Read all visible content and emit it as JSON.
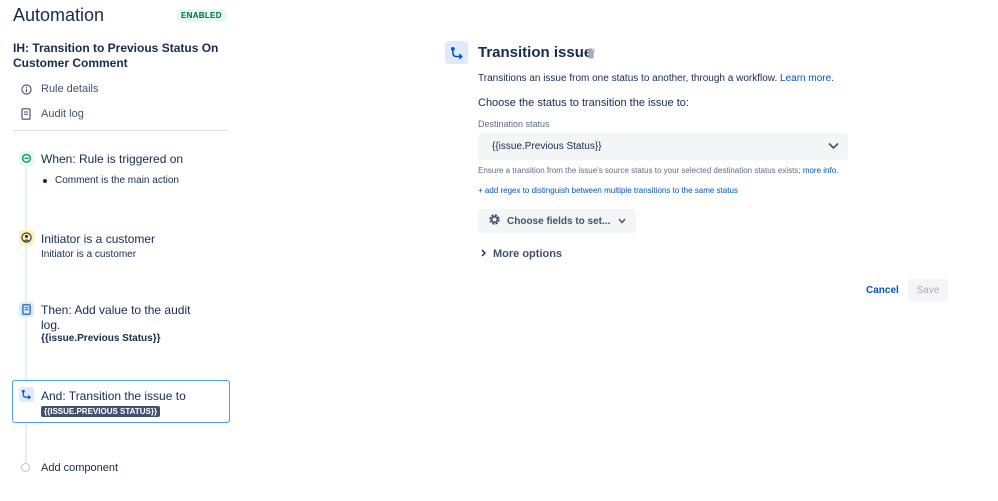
{
  "app": {
    "title": "Automation",
    "status_badge": "ENABLED"
  },
  "rule": {
    "name": "IH: Transition to Previous Status On Customer Comment"
  },
  "nav": [
    {
      "label": "Rule details",
      "icon": "info-icon"
    },
    {
      "label": "Audit log",
      "icon": "document-icon"
    }
  ],
  "steps": {
    "trigger": {
      "title": "When: Rule is triggered on",
      "bullet": "Comment is the main action",
      "icon": "speech-bubble-icon"
    },
    "condition": {
      "title": "Initiator is a customer",
      "subtitle": "Initiator is a customer",
      "icon": "user-circle-icon"
    },
    "action1": {
      "title_line1": "Then: Add value to the audit",
      "title_line2": "log.",
      "value": "{{issue.Previous Status}}",
      "icon": "audit-log-icon"
    },
    "action2": {
      "title": "And: Transition the issue to",
      "tag": "{{ISSUE.PREVIOUS STATUS}}",
      "icon": "transition-icon"
    },
    "add": {
      "label": "Add component"
    }
  },
  "panel": {
    "title": "Transition issue",
    "description": "Transitions an issue from one status to another, through a workflow.",
    "learn_more": "Learn more.",
    "choose_label": "Choose the status to transition the issue to:",
    "destination_label": "Destination status",
    "destination_value": "{{issue.Previous Status}}",
    "help_text": "Ensure a transition from the issue's source status to your selected destination status exists;",
    "help_link": "more info.",
    "regex_link": "+ add regex to distinguish between multiple transitions to the same status",
    "fields_button": "Choose fields to set...",
    "more_options": "More options",
    "cancel": "Cancel",
    "save": "Save"
  },
  "colors": {
    "accent": "#0052cc",
    "selected_border": "#4c9aff",
    "badge_bg": "#e3fcef",
    "badge_text": "#006644",
    "condition_bg": "#fff0b3",
    "trigger_bg": "#e3fcef"
  }
}
